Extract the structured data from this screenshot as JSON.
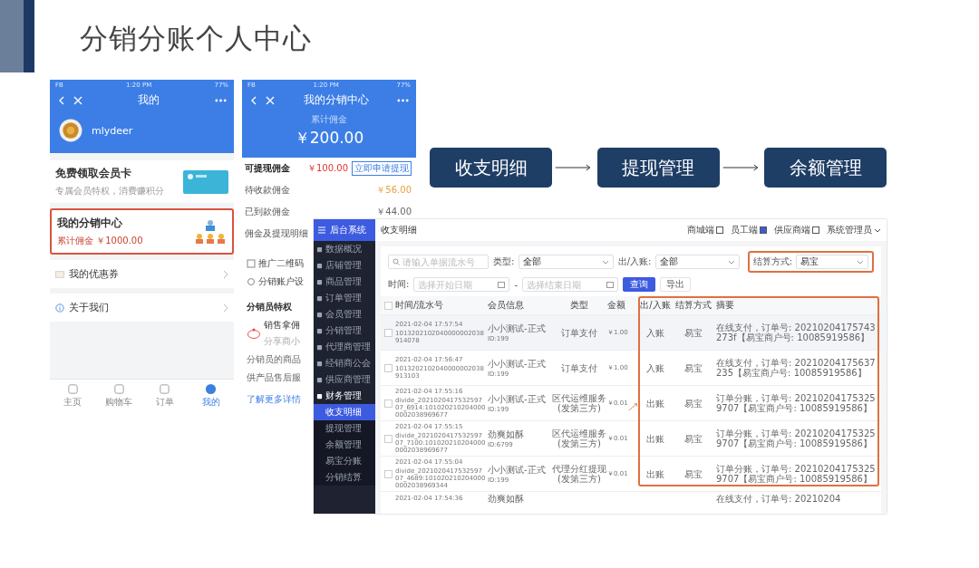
{
  "slide": {
    "title": "分销分账个人中心"
  },
  "phone_profile": {
    "status_bar": {
      "carrier": "FB",
      "time": "1:20 PM",
      "battery": "77%"
    },
    "title": "我的",
    "username": "mlydeer",
    "member_card": {
      "title": "免费领取会员卡",
      "subtitle": "专属会员特权，消费赚积分"
    },
    "distribution_center": {
      "title": "我的分销中心",
      "commission": "累计佣金 ￥1000.00",
      "highlighted": true
    },
    "menu": [
      {
        "label": "我的优惠券"
      },
      {
        "label": "关于我们"
      }
    ],
    "tabbar": [
      {
        "label": "主页",
        "selected": false
      },
      {
        "label": "购物车",
        "selected": false
      },
      {
        "label": "订单",
        "selected": false
      },
      {
        "label": "我的",
        "selected": true
      }
    ]
  },
  "phone_distribution": {
    "status_bar": {
      "carrier": "FB",
      "time": "1:20 PM",
      "battery": "77%"
    },
    "title": "我的分销中心",
    "total_label": "累计佣金",
    "total": "￥200.00",
    "rows": [
      {
        "label": "可提现佣金",
        "value": "￥100.00",
        "kind": "action",
        "button": "立即申请提现"
      },
      {
        "label": "待收款佣金",
        "value": "￥56.00",
        "kind": "pending"
      },
      {
        "label": "已到款佣金",
        "value": "￥44.00",
        "kind": "plain"
      },
      {
        "label": "佣金及提现明细",
        "kind": "link"
      }
    ],
    "tools": [
      {
        "label": "推广二维码"
      },
      {
        "label": "分销账户设"
      }
    ],
    "privileges": {
      "title": "分销员特权",
      "item_title": "销售拿佣",
      "item_subtitle": "分享商小",
      "text": [
        "分销员的商品",
        "供产品售后服"
      ],
      "link": "了解更多详情"
    }
  },
  "flow": [
    {
      "label": "收支明细"
    },
    {
      "label": "提现管理"
    },
    {
      "label": "余额管理"
    }
  ],
  "admin": {
    "brand": "后台系统",
    "page_title": "收支明细",
    "header_links": [
      {
        "label": "商城端"
      },
      {
        "label": "员工端"
      },
      {
        "label": "供应商端"
      }
    ],
    "user": "系统管理员",
    "sidebar": [
      {
        "label": "数据概况",
        "expanded": false
      },
      {
        "label": "店铺管理",
        "expanded": false
      },
      {
        "label": "商品管理",
        "expanded": false
      },
      {
        "label": "订单管理",
        "expanded": false
      },
      {
        "label": "会员管理",
        "expanded": false
      },
      {
        "label": "分销管理",
        "expanded": false
      },
      {
        "label": "代理商管理",
        "expanded": false
      },
      {
        "label": "经销商公会",
        "expanded": false
      },
      {
        "label": "供应商管理",
        "expanded": false
      },
      {
        "label": "财务管理",
        "expanded": true,
        "children": [
          {
            "label": "收支明细",
            "selected": true
          },
          {
            "label": "提现管理",
            "selected": false
          },
          {
            "label": "余额管理",
            "selected": false
          },
          {
            "label": "易宝分账",
            "selected": false
          },
          {
            "label": "分销结算",
            "selected": false
          }
        ]
      }
    ],
    "filters": {
      "search_placeholder": "请输入单据流水号",
      "type_label": "类型:",
      "type_value": "全部",
      "direction_label": "出/入账:",
      "direction_value": "全部",
      "settlement_label": "结算方式:",
      "settlement_value": "易宝",
      "settlement_highlighted": true,
      "time_label": "时间:",
      "start_placeholder": "选择开始日期",
      "separator": "-",
      "end_placeholder": "选择结束日期",
      "query_button": "查询",
      "export_button": "导出"
    },
    "table": {
      "columns": [
        "时间/流水号",
        "会员信息",
        "类型",
        "金额",
        "出/入账",
        "结算方式",
        "摘要"
      ],
      "highlight_columns": true,
      "select_all_checked": false,
      "rows": [
        {
          "time": "2021-02-04 17:57:54",
          "serial": "1013202102040000002038914078",
          "member": "小小测试-正式",
          "member_id": "ID:199",
          "type": "订单支付",
          "amount": "￥1.00",
          "direction": "入账",
          "settlement": "易宝",
          "summary": "在线支付，订单号: 20210204175743273f【易宝商户号: 10085919586】",
          "hovered": true,
          "checked": false
        },
        {
          "time": "2021-02-04 17:56:47",
          "serial": "1013202102040000002038913103",
          "member": "小小测试-正式",
          "member_id": "ID:199",
          "type": "订单支付",
          "amount": "￥1.00",
          "direction": "入账",
          "settlement": "易宝",
          "summary": "在线支付，订单号: 20210204175637235【易宝商户号: 10085919586】",
          "hovered": false,
          "checked": false
        },
        {
          "time": "2021-02-04 17:55:16",
          "serial": "divide_202102041753259707_6914:1010202102040000002038969677",
          "member": "小小测试-正式",
          "member_id": "ID:199",
          "type": "区代运维服务(发第三方)",
          "amount": "￥0.01",
          "direction": "出账",
          "settlement": "易宝",
          "summary": "订单分账，订单号: 202102041753259707【易宝商户号: 10085919586】",
          "hovered": false,
          "checked": false
        },
        {
          "time": "2021-02-04 17:55:15",
          "serial": "divide_202102041753259707_7100:1010202102040000002038969677",
          "member": "劲爽如酥",
          "member_id": "ID:6799",
          "type": "区代运维服务(发第三方)",
          "amount": "￥0.01",
          "direction": "出账",
          "settlement": "易宝",
          "summary": "订单分账，订单号: 202102041753259707【易宝商户号: 10085919586】",
          "hovered": false,
          "checked": false
        },
        {
          "time": "2021-02-04 17:55:04",
          "serial": "divide_202102041753259707_4689:1010202102040000002038969344",
          "member": "小小测试-正式",
          "member_id": "ID:199",
          "type": "代理分红提现(发第三方)",
          "amount": "￥0.01",
          "direction": "出账",
          "settlement": "易宝",
          "summary": "订单分账，订单号: 202102041753259707【易宝商户号: 10085919586】",
          "hovered": false,
          "checked": false
        }
      ],
      "partial_row": {
        "time": "2021-02-04 17:54:36",
        "member": "劲爽如酥",
        "summary": "在线支付，订单号: 20210204"
      }
    }
  }
}
